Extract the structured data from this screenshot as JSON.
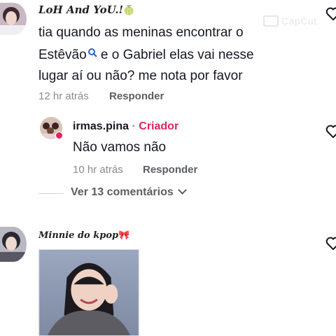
{
  "watermark": {
    "text": "CapCut"
  },
  "comments": [
    {
      "username": "LoH And YoU.!",
      "username_emoji": "🍈",
      "text_line1": "tia quando as meninas encontrar o",
      "text_line2_a": "Estêvão",
      "text_line2_b": " e o Gabriel elas vai nesse",
      "text_line3": "lugar aí ou não? me nota por favor",
      "time": "12 hr atrás",
      "reply_label": "Responder"
    },
    {
      "username": "irmas.pina",
      "separator": "·",
      "badge": "Criador",
      "text": "Não vamos não",
      "time": "10 hr atrás",
      "reply_label": "Responder"
    },
    {
      "username": "Minnie do kpop",
      "username_emoji": "🎀"
    }
  ],
  "view_more": {
    "label": "Ver 13 comentários"
  },
  "icons": [
    "heart-icon",
    "search-icon",
    "chevron-down-icon",
    "avatar"
  ]
}
